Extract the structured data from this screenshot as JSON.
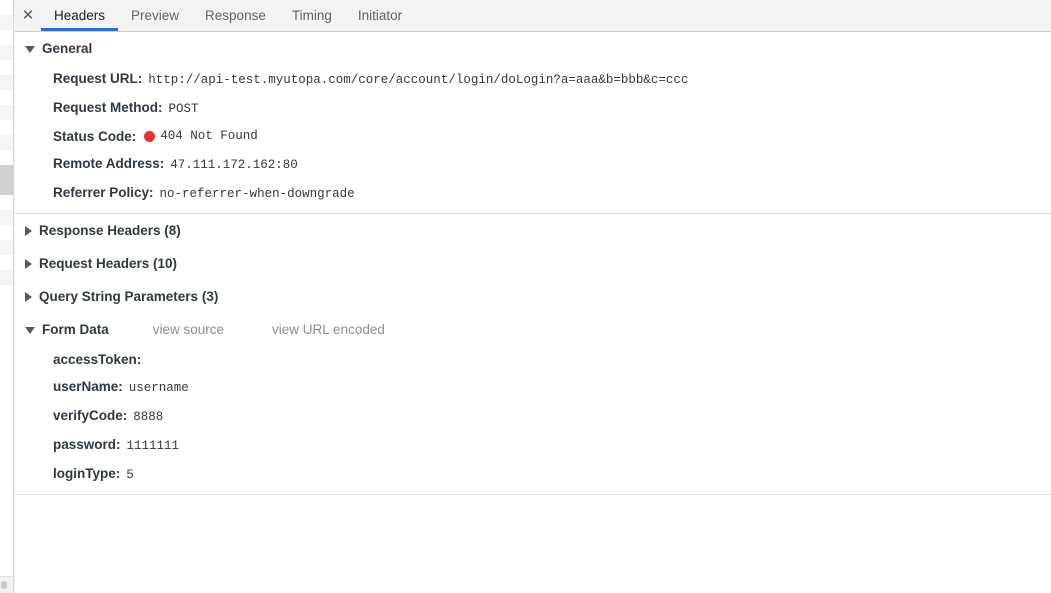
{
  "tabs": {
    "close_icon": "close-icon",
    "items": [
      {
        "label": "Headers",
        "active": true
      },
      {
        "label": "Preview",
        "active": false
      },
      {
        "label": "Response",
        "active": false
      },
      {
        "label": "Timing",
        "active": false
      },
      {
        "label": "Initiator",
        "active": false
      }
    ]
  },
  "general": {
    "title": "General",
    "expanded": true,
    "rows": [
      {
        "key": "Request URL:",
        "value": "http://api-test.myutopa.com/core/account/login/doLogin?a=aaa&b=bbb&c=ccc"
      },
      {
        "key": "Request Method:",
        "value": "POST"
      },
      {
        "key": "Status Code:",
        "value": "404 Not Found",
        "status_dot": true,
        "status_color": "#e8332a"
      },
      {
        "key": "Remote Address:",
        "value": "47.111.172.162:80"
      },
      {
        "key": "Referrer Policy:",
        "value": "no-referrer-when-downgrade"
      }
    ]
  },
  "collapsed_sections": [
    {
      "title": "Response Headers (8)",
      "expanded": false
    },
    {
      "title": "Request Headers (10)",
      "expanded": false
    },
    {
      "title": "Query String Parameters (3)",
      "expanded": false
    }
  ],
  "form_data": {
    "title": "Form Data",
    "expanded": true,
    "links": [
      {
        "label": "view source"
      },
      {
        "label": "view URL encoded"
      }
    ],
    "rows": [
      {
        "key": "accessToken:",
        "value": ""
      },
      {
        "key": "userName:",
        "value": "username"
      },
      {
        "key": "verifyCode:",
        "value": "8888"
      },
      {
        "key": "password:",
        "value": "1111111"
      },
      {
        "key": "loginType:",
        "value": "5"
      }
    ]
  },
  "colors": {
    "accent": "#1a73e8",
    "status_error": "#e8332a",
    "tab_bar_bg": "#f3f3f3",
    "link": "#8d8d8d"
  }
}
